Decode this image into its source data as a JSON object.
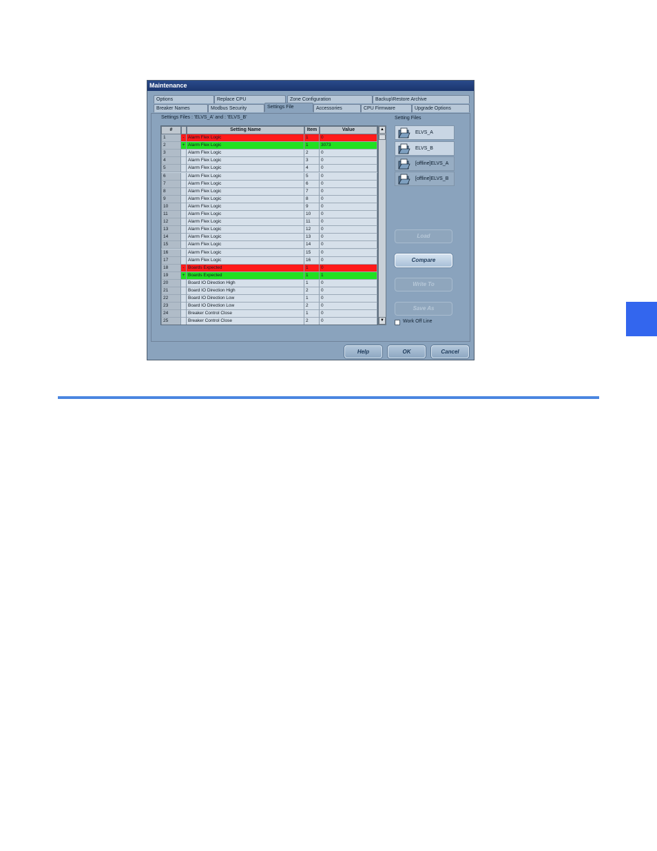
{
  "dialog": {
    "title": "Maintenance",
    "tabs_row1": [
      "Options",
      "Replace CPU",
      "Zone Configuration",
      "Backup\\Restore Archive"
    ],
    "tabs_row2": [
      "Breaker Names",
      "Modbus Security",
      "Settings File",
      "Accessories",
      "CPU Firmware",
      "Upgrade Options"
    ],
    "active_tab": "Settings File",
    "panel_label": "Settings Files : 'ELVS_A' and : 'ELVS_B'",
    "files_label": "Setting Files",
    "grid": {
      "headers": [
        "#",
        "",
        "Setting Name",
        "Item",
        "Value"
      ],
      "rows": [
        {
          "num": "1",
          "mark": "-",
          "name": "Alarm Flex Logic",
          "item": "1",
          "value": "0",
          "state": "red"
        },
        {
          "num": "2",
          "mark": "+",
          "name": "Alarm Flex Logic",
          "item": "1",
          "value": "3073",
          "state": "green"
        },
        {
          "num": "3",
          "mark": "",
          "name": "Alarm Flex Logic",
          "item": "2",
          "value": "0",
          "state": "normal"
        },
        {
          "num": "4",
          "mark": "",
          "name": "Alarm Flex Logic",
          "item": "3",
          "value": "0",
          "state": "normal"
        },
        {
          "num": "5",
          "mark": "",
          "name": "Alarm Flex Logic",
          "item": "4",
          "value": "0",
          "state": "normal"
        },
        {
          "num": "6",
          "mark": "",
          "name": "Alarm Flex Logic",
          "item": "5",
          "value": "0",
          "state": "normal"
        },
        {
          "num": "7",
          "mark": "",
          "name": "Alarm Flex Logic",
          "item": "6",
          "value": "0",
          "state": "normal"
        },
        {
          "num": "8",
          "mark": "",
          "name": "Alarm Flex Logic",
          "item": "7",
          "value": "0",
          "state": "normal"
        },
        {
          "num": "9",
          "mark": "",
          "name": "Alarm Flex Logic",
          "item": "8",
          "value": "0",
          "state": "normal"
        },
        {
          "num": "10",
          "mark": "",
          "name": "Alarm Flex Logic",
          "item": "9",
          "value": "0",
          "state": "normal"
        },
        {
          "num": "11",
          "mark": "",
          "name": "Alarm Flex Logic",
          "item": "10",
          "value": "0",
          "state": "normal"
        },
        {
          "num": "12",
          "mark": "",
          "name": "Alarm Flex Logic",
          "item": "11",
          "value": "0",
          "state": "normal"
        },
        {
          "num": "13",
          "mark": "",
          "name": "Alarm Flex Logic",
          "item": "12",
          "value": "0",
          "state": "normal"
        },
        {
          "num": "14",
          "mark": "",
          "name": "Alarm Flex Logic",
          "item": "13",
          "value": "0",
          "state": "normal"
        },
        {
          "num": "15",
          "mark": "",
          "name": "Alarm Flex Logic",
          "item": "14",
          "value": "0",
          "state": "normal"
        },
        {
          "num": "16",
          "mark": "",
          "name": "Alarm Flex Logic",
          "item": "15",
          "value": "0",
          "state": "normal"
        },
        {
          "num": "17",
          "mark": "",
          "name": "Alarm Flex Logic",
          "item": "16",
          "value": "0",
          "state": "normal"
        },
        {
          "num": "18",
          "mark": "-",
          "name": "Boards Expected",
          "item": "1",
          "value": "0",
          "state": "red"
        },
        {
          "num": "19",
          "mark": "+",
          "name": "Boards Expected",
          "item": "1",
          "value": "1",
          "state": "green"
        },
        {
          "num": "20",
          "mark": "",
          "name": "Board IO Direction High",
          "item": "1",
          "value": "0",
          "state": "normal"
        },
        {
          "num": "21",
          "mark": "",
          "name": "Board IO Direction High",
          "item": "2",
          "value": "0",
          "state": "normal"
        },
        {
          "num": "22",
          "mark": "",
          "name": "Board IO Direction Low",
          "item": "1",
          "value": "0",
          "state": "normal"
        },
        {
          "num": "23",
          "mark": "",
          "name": "Board IO Direction Low",
          "item": "2",
          "value": "0",
          "state": "normal"
        },
        {
          "num": "24",
          "mark": "",
          "name": "Breaker Control Close",
          "item": "1",
          "value": "0",
          "state": "normal"
        },
        {
          "num": "25",
          "mark": "",
          "name": "Breaker Control Close",
          "item": "2",
          "value": "0",
          "state": "normal"
        }
      ]
    },
    "files": [
      {
        "name": "ELVS_A",
        "selected": true
      },
      {
        "name": "ELVS_B",
        "selected": true
      },
      {
        "name": "[offline]ELVS_A",
        "selected": false
      },
      {
        "name": "[offline]ELVS_B",
        "selected": false
      }
    ],
    "buttons": {
      "load": "Load",
      "compare": "Compare",
      "write_to": "Write To",
      "save_as": "Save As",
      "help": "Help",
      "ok": "OK",
      "cancel": "Cancel"
    },
    "work_offline_label": "Work Off Line",
    "work_offline_checked": false
  },
  "colors": {
    "diff_removed": "#ff1a1a",
    "diff_added": "#22e022",
    "dialog_bg": "#8aa3bd",
    "title_bar": "#1a356e",
    "side_tab": "#3366ee",
    "rule": "#4a86e0"
  }
}
